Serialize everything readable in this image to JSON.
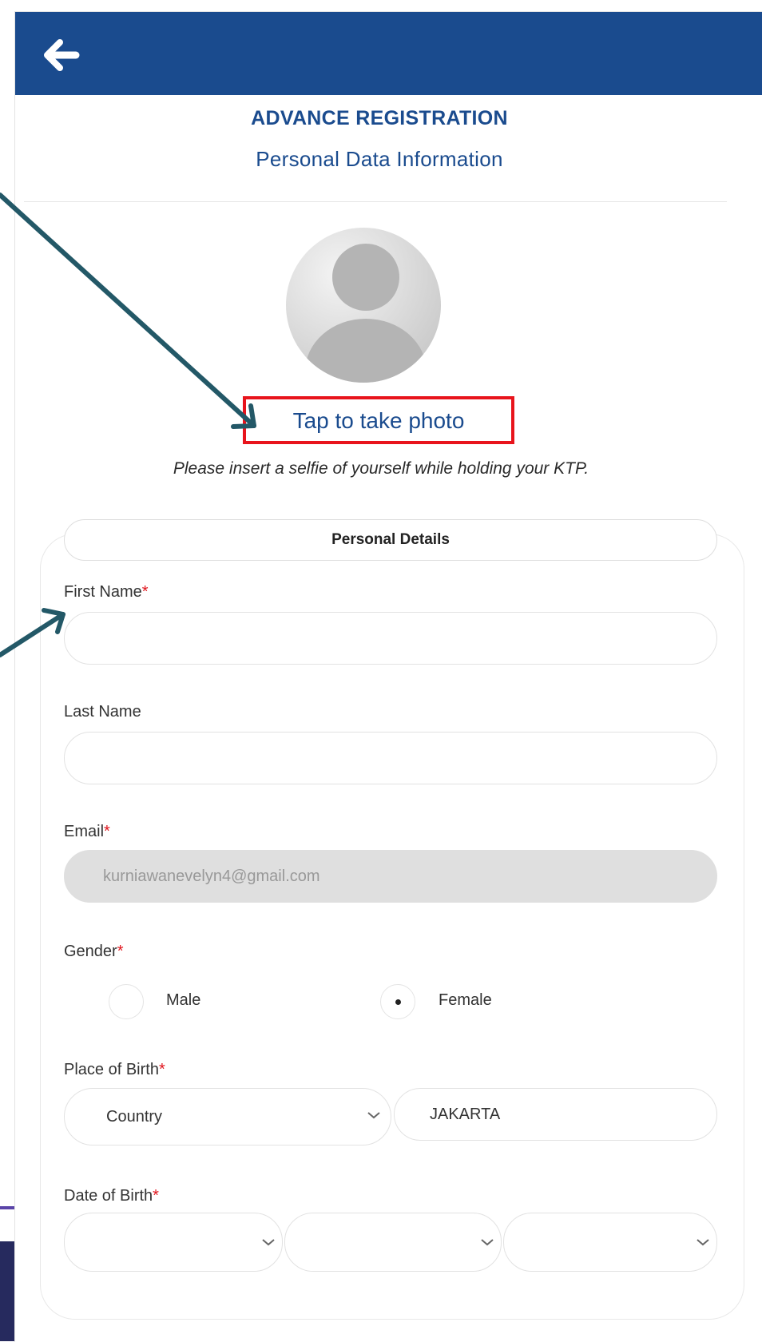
{
  "header": {
    "back_icon": "arrow-left-icon",
    "color": "#1a4b8e"
  },
  "page": {
    "title": "ADVANCE REGISTRATION",
    "subtitle": "Personal Data Information"
  },
  "photo": {
    "avatar_icon": "user-avatar-icon",
    "tap_label": "Tap to take photo",
    "hint": "Please insert a selfie of yourself while holding your KTP."
  },
  "personal_details": {
    "heading": "Personal Details",
    "first_name": {
      "label": "First Name",
      "required_mark": "*",
      "value": ""
    },
    "last_name": {
      "label": "Last Name",
      "value": ""
    },
    "email": {
      "label": "Email",
      "required_mark": "*",
      "value": "kurniawanevelyn4@gmail.com"
    },
    "gender": {
      "label": "Gender",
      "required_mark": "*",
      "options": [
        "Male",
        "Female"
      ],
      "selected": "Female"
    },
    "place_of_birth": {
      "label": "Place of Birth",
      "required_mark": "*",
      "country_value": "Country",
      "city_value": "JAKARTA"
    },
    "date_of_birth": {
      "label": "Date of Birth",
      "required_mark": "*",
      "day": "",
      "month": "",
      "year": ""
    }
  },
  "colors": {
    "accent": "#1a4b8e",
    "required": "#e0141c",
    "highlight_box": "#e8141c",
    "annotation_arrow": "#235867"
  }
}
